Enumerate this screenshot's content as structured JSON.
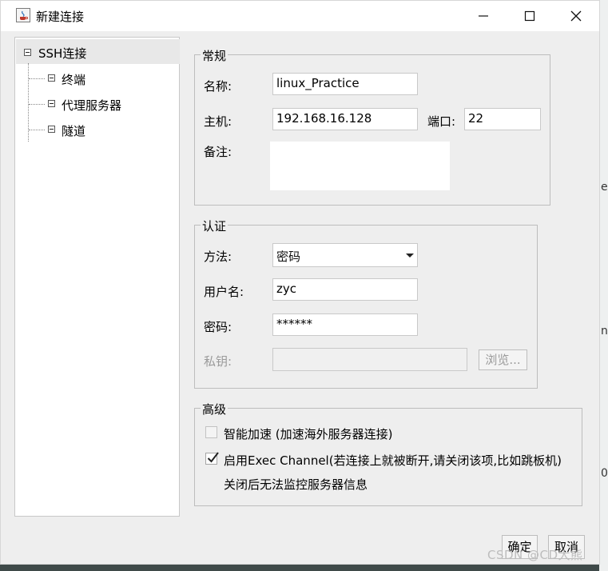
{
  "window": {
    "title": "新建连接"
  },
  "tree": {
    "root": "SSH连接",
    "children": [
      "终端",
      "代理服务器",
      "隧道"
    ]
  },
  "general": {
    "title": "常规",
    "name_label": "名称:",
    "name_value": "linux_Practice",
    "host_label": "主机:",
    "host_value": "192.168.16.128",
    "port_label": "端口:",
    "port_value": "22",
    "note_label": "备注:"
  },
  "auth": {
    "title": "认证",
    "method_label": "方法:",
    "method_value": "密码",
    "user_label": "用户名:",
    "user_value": "zyc",
    "password_label": "密码:",
    "password_value": "******",
    "key_label": "私钥:",
    "browse_label": "浏览..."
  },
  "advanced": {
    "title": "高级",
    "accel_label": "智能加速 (加速海外服务器连接)",
    "accel_checked": false,
    "exec_label": "启用Exec Channel(若连接上就被断开,请关闭该项,比如跳板机)",
    "exec_checked": true,
    "exec_note": "关闭后无法监控服务器信息"
  },
  "footer": {
    "ok_label": "确定",
    "cancel_label": "取消"
  },
  "watermark": "CSDN @CD大熊",
  "background_fragments": [
    "e",
    "n",
    "0"
  ]
}
